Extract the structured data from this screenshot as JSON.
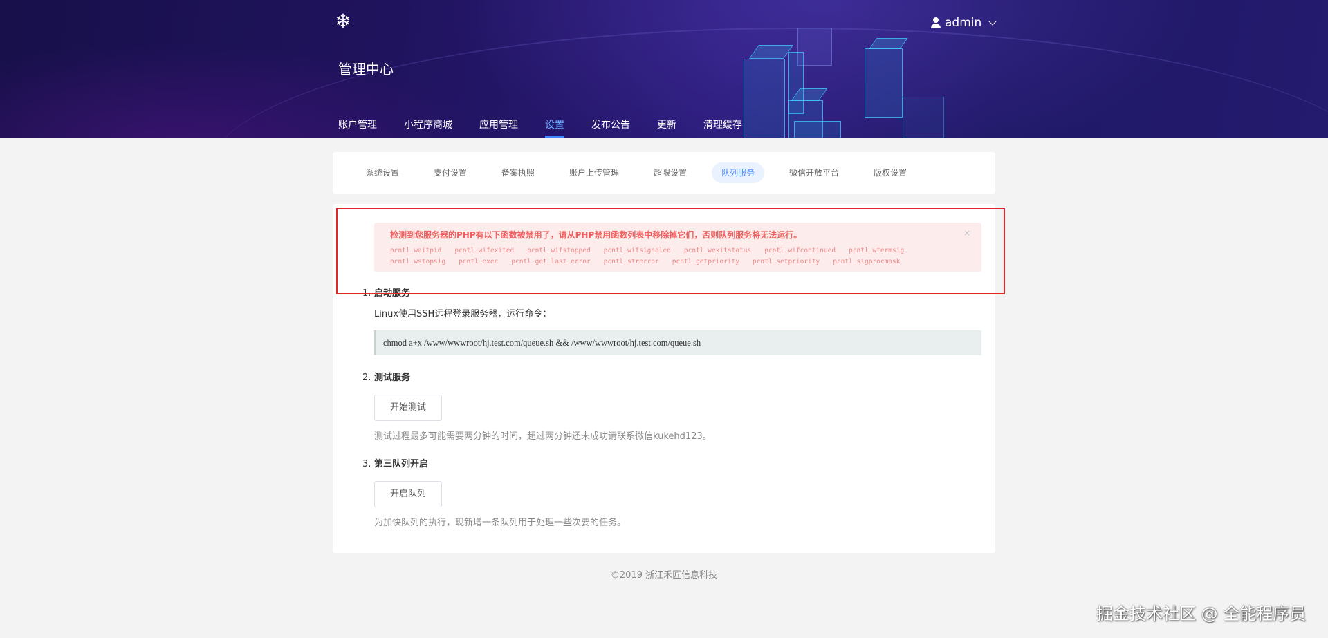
{
  "header": {
    "site_title": "管理中心",
    "user": "admin",
    "logo_icon": "snowflake-icon",
    "nav": [
      {
        "label": "账户管理",
        "active": false
      },
      {
        "label": "小程序商城",
        "active": false
      },
      {
        "label": "应用管理",
        "active": false
      },
      {
        "label": "设置",
        "active": true
      },
      {
        "label": "发布公告",
        "active": false
      },
      {
        "label": "更新",
        "active": false
      },
      {
        "label": "清理缓存",
        "active": false
      }
    ]
  },
  "subtabs": [
    {
      "label": "系统设置",
      "active": false
    },
    {
      "label": "支付设置",
      "active": false
    },
    {
      "label": "备案执照",
      "active": false
    },
    {
      "label": "账户上传管理",
      "active": false
    },
    {
      "label": "超限设置",
      "active": false
    },
    {
      "label": "队列服务",
      "active": true
    },
    {
      "label": "微信开放平台",
      "active": false
    },
    {
      "label": "版权设置",
      "active": false
    }
  ],
  "alert": {
    "title": "检测到您服务器的PHP有以下函数被禁用了，请从PHP禁用函数列表中移除掉它们，否则队列服务将无法运行。",
    "close": "×",
    "functions_row1": [
      "pcntl_waitpid",
      "pcntl_wifexited",
      "pcntl_wifstopped",
      "pcntl_wifsignaled",
      "pcntl_wexitstatus",
      "pcntl_wifcontinued",
      "pcntl_wtermsig"
    ],
    "functions_row2": [
      "pcntl_wstopsig",
      "pcntl_exec",
      "pcntl_get_last_error",
      "pcntl_strerror",
      "pcntl_getpriority",
      "pcntl_setpriority",
      "pcntl_sigprocmask"
    ]
  },
  "steps": {
    "s1": {
      "num": "1.",
      "title": "启动服务",
      "desc": "Linux使用SSH远程登录服务器，运行命令：",
      "command": "chmod a+x /www/wwwroot/hj.test.com/queue.sh && /www/wwwroot/hj.test.com/queue.sh"
    },
    "s2": {
      "num": "2.",
      "title": "测试服务",
      "button": "开始测试",
      "note": "测试过程最多可能需要两分钟的时间，超过两分钟还未成功请联系微信kukehd123。"
    },
    "s3": {
      "num": "3.",
      "title": "第三队列开启",
      "button": "开启队列",
      "note": "为加快队列的执行，现新增一条队列用于处理一些次要的任务。"
    }
  },
  "footer": "©2019 浙江禾匠信息科技",
  "watermark": "掘金技术社区 @ 全能程序员"
}
